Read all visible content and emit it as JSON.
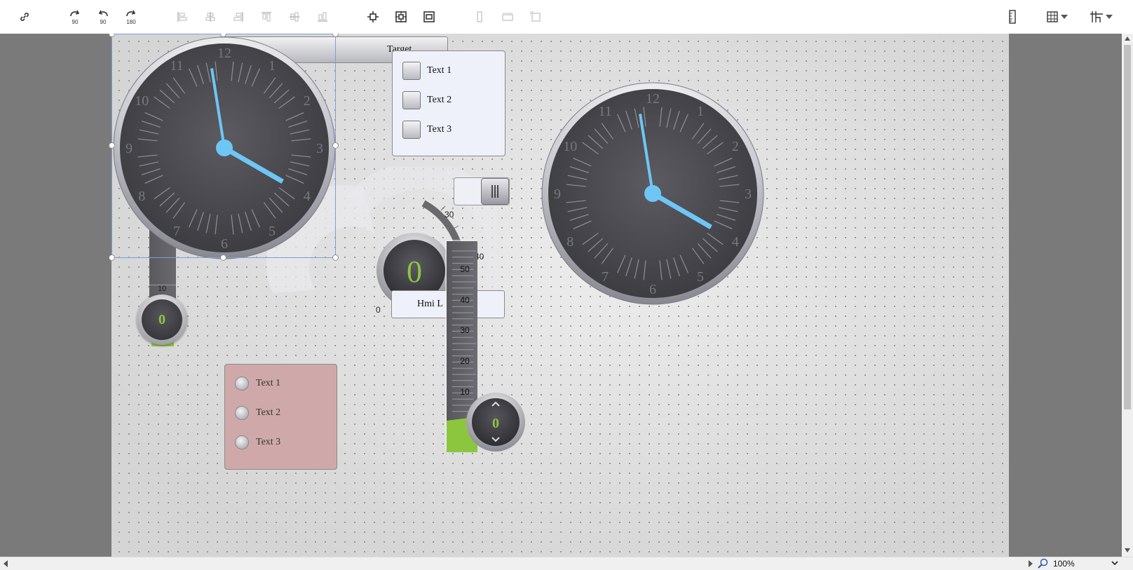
{
  "toolbar": {
    "rotate_cw_label": "90",
    "rotate_ccw_label": "90",
    "rotate_180_label": "180",
    "icons": [
      "link-icon",
      "rotate-cw-90-icon",
      "rotate-ccw-90-icon",
      "rotate-180-icon",
      "align-left-icon",
      "align-center-icon",
      "align-right-icon",
      "align-top-icon",
      "align-middle-icon",
      "align-bottom-icon",
      "center-icon",
      "group-icon",
      "ungroup-icon",
      "same-width-icon",
      "same-height-icon",
      "same-size-icon",
      "ruler-icon",
      "grid-icon",
      "snap-icon"
    ]
  },
  "canvas": {
    "target_button_label": "Target",
    "hmi_label_text": "Hmi L",
    "checkbox_group": {
      "items": [
        "Text 1",
        "Text 2",
        "Text 3"
      ]
    },
    "radio_group": {
      "items": [
        "Text 1",
        "Text 2",
        "Text 3"
      ]
    },
    "clock_numbers": [
      "12",
      "1",
      "2",
      "3",
      "4",
      "5",
      "6",
      "7",
      "8",
      "9",
      "10",
      "11"
    ],
    "gauge": {
      "value": "0",
      "ticks": [
        "0",
        "30",
        "40",
        "50"
      ]
    },
    "small_slider": {
      "value": "0",
      "tick": "10"
    },
    "vertical_slider": {
      "value": "0",
      "ticks": [
        "50",
        "40",
        "30",
        "20",
        "10"
      ]
    }
  },
  "statusbar": {
    "zoom": "100%"
  },
  "colors": {
    "accent": "#6ec6f5",
    "value_green": "#8cc63f",
    "radio_group_bg": "#cfa9a9",
    "face": "#4a4a4e"
  }
}
